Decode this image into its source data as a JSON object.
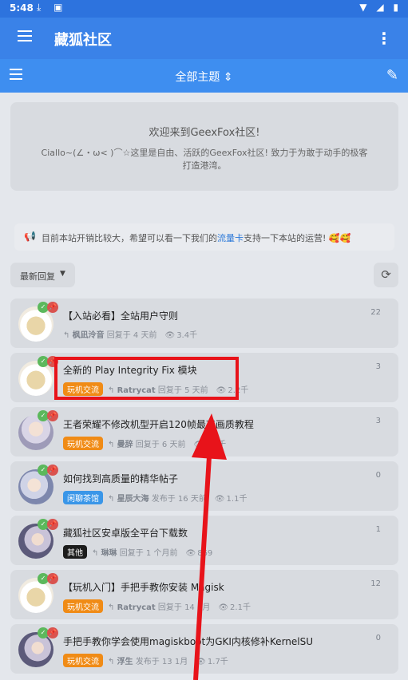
{
  "status": {
    "time": "5:48"
  },
  "appbar": {
    "title": "藏狐社区",
    "menu_icon": "hamburger-icon",
    "more_icon": "more-vertical-icon"
  },
  "toolbar": {
    "center": "全部主题",
    "sort_symbol": "⇕"
  },
  "hero": {
    "title": "欢迎来到GeexFox社区!",
    "description": "Ciallo~(∠・ω< )⌒☆这里是自由、活跃的GeexFox社区! 致力于为敢于动手的极客打造港湾。"
  },
  "notice": {
    "text_before": "目前本站开销比较大，希望可以看一下我们的",
    "link": "流量卡",
    "text_after": "支持一下本站的运营! 🥰🥰"
  },
  "sort": {
    "label": "最新回复"
  },
  "colors": {
    "statusbar": "#2d73de",
    "appbar": "#3a82e8",
    "toolbar": "#3e8ef0",
    "tag_orange": "#f08b16",
    "tag_blue": "#3a96e8",
    "tag_black": "#1c1c1c",
    "annotation": "#e8131a"
  },
  "topics": [
    {
      "title": "【入站必看】全站用户守则",
      "tag": "",
      "user": "枫凪泠音",
      "action": "回复于 4 天前",
      "views": "3.4千",
      "count": "22",
      "avatar": "food"
    },
    {
      "title": "全新的 Play Integrity Fix 模块",
      "tag": "玩机交流",
      "tag_color": "orange",
      "user": "Ratrycat",
      "action": "回复于 5 天前",
      "views": "2.2千",
      "count": "3",
      "avatar": "food"
    },
    {
      "title": "王者荣耀不修改机型开启120帧最高画质教程",
      "tag": "玩机交流",
      "tag_color": "orange",
      "user": "曼辞",
      "action": "回复于 6 天前",
      "views": "1.9千",
      "count": "3",
      "avatar": "girl1"
    },
    {
      "title": "如何找到高质量的精华帖子",
      "tag": "闲聊茶馆",
      "tag_color": "blue",
      "user": "星辰大海",
      "action": "发布于 16 天前",
      "views": "1.1千",
      "count": "0",
      "avatar": "girl2"
    },
    {
      "title": "藏狐社区安卓版全平台下载数",
      "tag": "其他",
      "tag_color": "black",
      "user": "琳琳",
      "action": "回复于 1 个月前",
      "views": "869",
      "count": "1",
      "avatar": "girl3"
    },
    {
      "title": "【玩机入门】手把手教你安装 Magisk",
      "tag": "玩机交流",
      "tag_color": "orange",
      "user": "Ratrycat",
      "action": "回复于 14 1月",
      "views": "2.1千",
      "count": "12",
      "avatar": "food"
    },
    {
      "title": "手把手教你学会使用magiskboot为GKI内核修补KernelSU",
      "tag": "玩机交流",
      "tag_color": "orange",
      "user": "浮生",
      "action": "发布于 13 1月",
      "views": "1.7千",
      "count": "0",
      "avatar": "girl3"
    }
  ]
}
